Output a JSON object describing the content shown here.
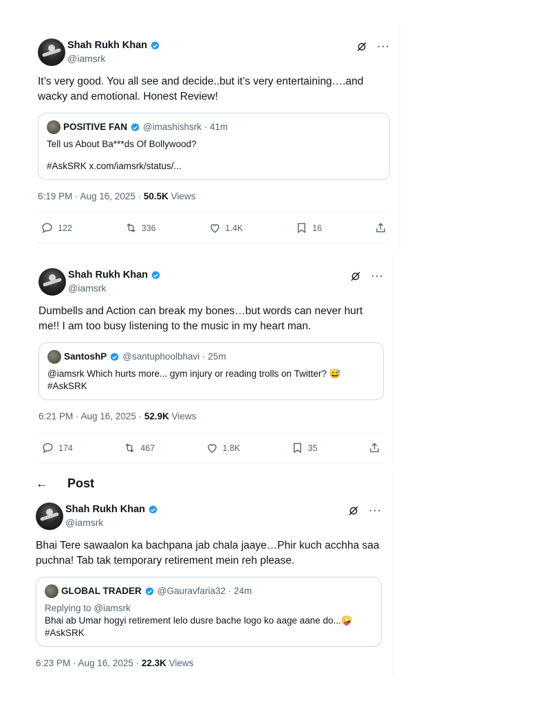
{
  "tweets": [
    {
      "author_name": "Shah Rukh Khan",
      "author_handle": "@iamsrk",
      "text": "It’s very good. You all see and decide..but it’s very entertaining….and wacky and emotional. Honest Review!",
      "quote": {
        "name": "POSITIVE FAN",
        "handle": "@imashishsrk · 41m",
        "reply": "",
        "line1": "Tell us About Ba***ds Of Bollywood?",
        "line2": "#AskSRK x.com/iamsrk/status/..."
      },
      "time": "6:19 PM · Aug 16, 2025 · ",
      "views_count": "50.5K",
      "views_label": " Views",
      "replies": "122",
      "reposts": "336",
      "likes": "1.4K",
      "bookmarks": "16"
    },
    {
      "author_name": "Shah Rukh Khan",
      "author_handle": "@iamsrk",
      "text": "Dumbells and Action can break my bones…but words can never hurt me!! I am too busy listening to the music in my heart man.",
      "quote": {
        "name": "SantoshP",
        "handle": "@santuphoolbhavi · 25m",
        "reply": "",
        "line1": "@iamsrk  Which hurts more... gym injury or reading trolls on Twitter? 😅",
        "line2": "#AskSRK"
      },
      "time": "6:21 PM · Aug 16, 2025 · ",
      "views_count": "52.9K",
      "views_label": " Views",
      "replies": "174",
      "reposts": "467",
      "likes": "1.8K",
      "bookmarks": "35"
    },
    {
      "author_name": "Shah Rukh Khan",
      "author_handle": "@iamsrk",
      "text": "Bhai Tere sawaalon ka bachpana jab chala jaaye…Phir kuch acchha saa puchna! Tab tak temporary retirement mein reh please.",
      "quote": {
        "name": "GLOBAL TRADER",
        "handle": "@Gauravfaria32 · 24m",
        "reply": "Replying to @iamsrk",
        "line1": "Bhai ab Umar hogyi retirement lelo dusre bache logo ko aage aane do...🤪",
        "line2": "#AskSRK"
      },
      "time": "6:23 PM · Aug 16, 2025 · ",
      "views_count": "22.3K",
      "views_label": " Views"
    }
  ],
  "post_header": {
    "back_icon": "←",
    "title": "Post"
  },
  "icons": {
    "verified": "verified-badge-icon",
    "grok": "grok-icon",
    "more": "more-icon",
    "reply": "reply-icon",
    "repost": "repost-icon",
    "like": "like-icon",
    "bookmark": "bookmark-icon",
    "share": "share-icon"
  },
  "colors": {
    "verified_blue": "#1d9bf0",
    "secondary_text": "#536471",
    "border": "#cfd9de"
  }
}
